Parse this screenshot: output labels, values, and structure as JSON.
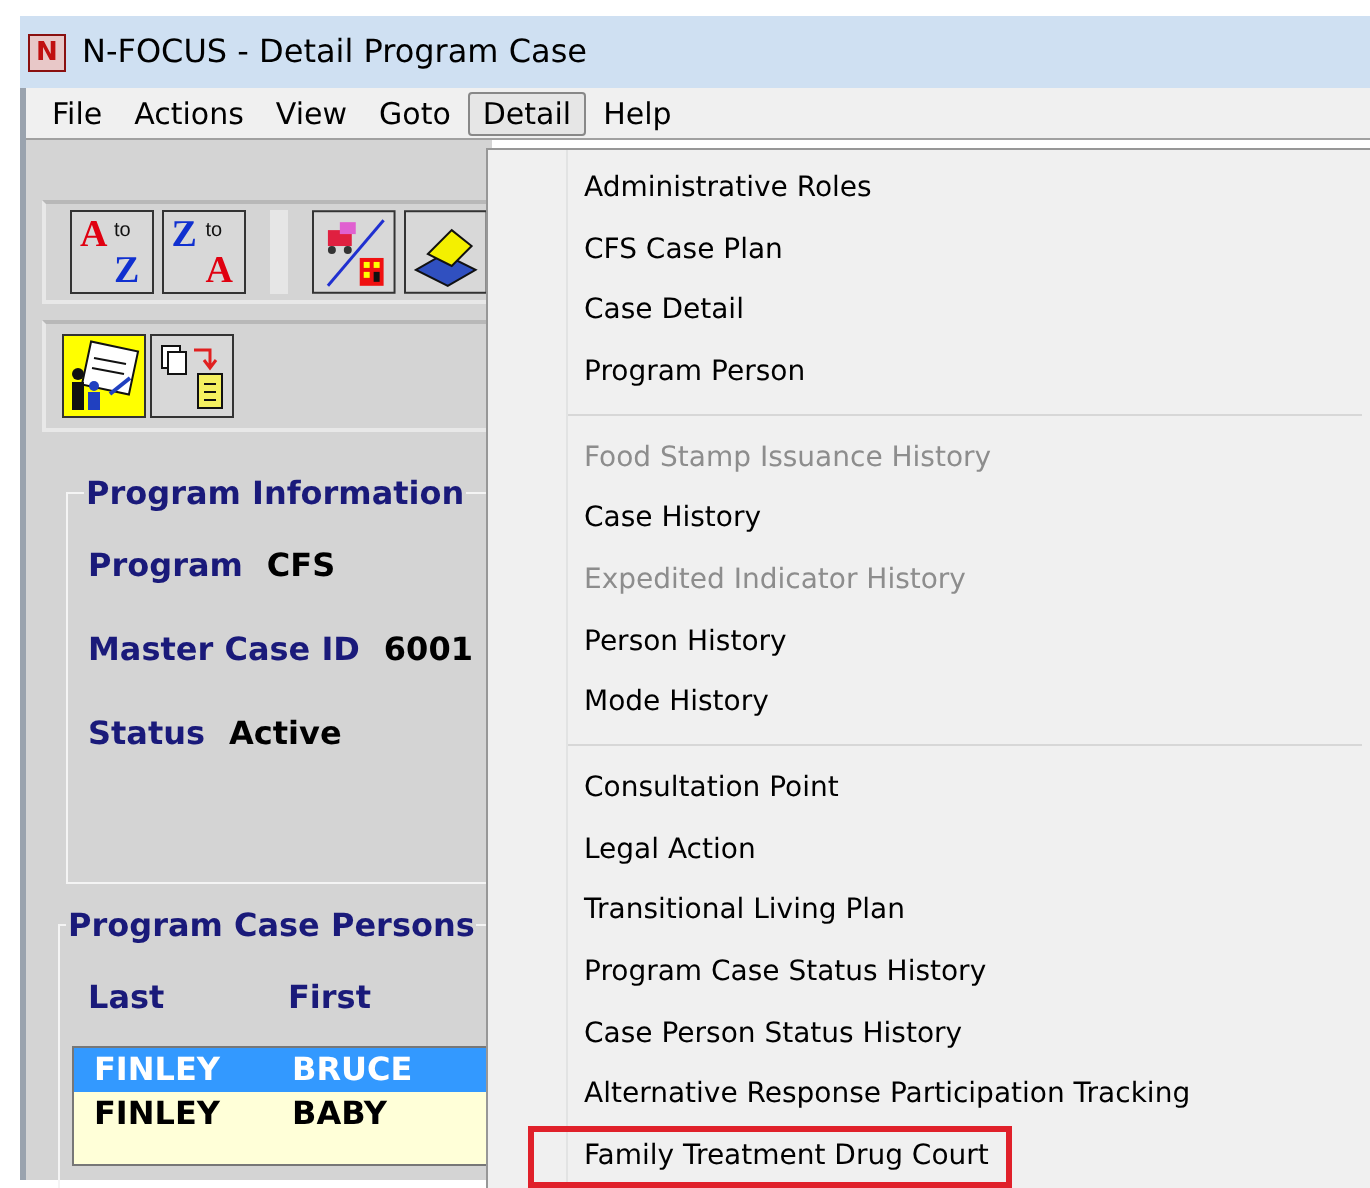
{
  "window": {
    "title": "N-FOCUS - Detail Program Case",
    "app_icon_letter": "N"
  },
  "sort_buttons": [
    {
      "top": "A",
      "middle": "to",
      "bottom": "Z"
    },
    {
      "top": "Z",
      "middle": "to",
      "bottom": "A"
    }
  ],
  "menubar": [
    {
      "label": "File",
      "selected": false
    },
    {
      "label": "Actions",
      "selected": false
    },
    {
      "label": "View",
      "selected": false
    },
    {
      "label": "Goto",
      "selected": false
    },
    {
      "label": "Detail",
      "selected": true
    },
    {
      "label": "Help",
      "selected": false
    }
  ],
  "program_information": {
    "title": "Program Information",
    "fields": [
      {
        "label": "Program",
        "value": "CFS"
      },
      {
        "label": "Master Case ID",
        "value": "6001"
      },
      {
        "label": "Status",
        "value": "Active"
      }
    ]
  },
  "program_case_persons": {
    "title": "Program Case Persons",
    "columns": [
      "Last",
      "First"
    ],
    "rows": [
      {
        "last": "FINLEY",
        "first": "BRUCE",
        "selected": true
      },
      {
        "last": "FINLEY",
        "first": "BABY",
        "selected": false
      }
    ]
  },
  "detail_menu": {
    "groups": [
      [
        {
          "label": "Administrative Roles",
          "disabled": false,
          "highlighted": false
        },
        {
          "label": "CFS Case Plan",
          "disabled": false,
          "highlighted": false
        },
        {
          "label": "Case Detail",
          "disabled": false,
          "highlighted": false
        },
        {
          "label": "Program Person",
          "disabled": false,
          "highlighted": false
        }
      ],
      [
        {
          "label": "Food Stamp Issuance History",
          "disabled": true,
          "highlighted": false
        },
        {
          "label": "Case History",
          "disabled": false,
          "highlighted": false
        },
        {
          "label": "Expedited Indicator History",
          "disabled": true,
          "highlighted": false
        },
        {
          "label": "Person History",
          "disabled": false,
          "highlighted": false
        },
        {
          "label": "Mode History",
          "disabled": false,
          "highlighted": false
        }
      ],
      [
        {
          "label": "Consultation Point",
          "disabled": false,
          "highlighted": false
        },
        {
          "label": "Legal Action",
          "disabled": false,
          "highlighted": false
        },
        {
          "label": "Transitional Living Plan",
          "disabled": false,
          "highlighted": false
        },
        {
          "label": "Program Case Status History",
          "disabled": false,
          "highlighted": false
        },
        {
          "label": "Case Person Status History",
          "disabled": false,
          "highlighted": false
        },
        {
          "label": "Alternative Response Participation Tracking",
          "disabled": false,
          "highlighted": false
        },
        {
          "label": "Family Treatment Drug Court",
          "disabled": false,
          "highlighted": true
        }
      ]
    ]
  }
}
